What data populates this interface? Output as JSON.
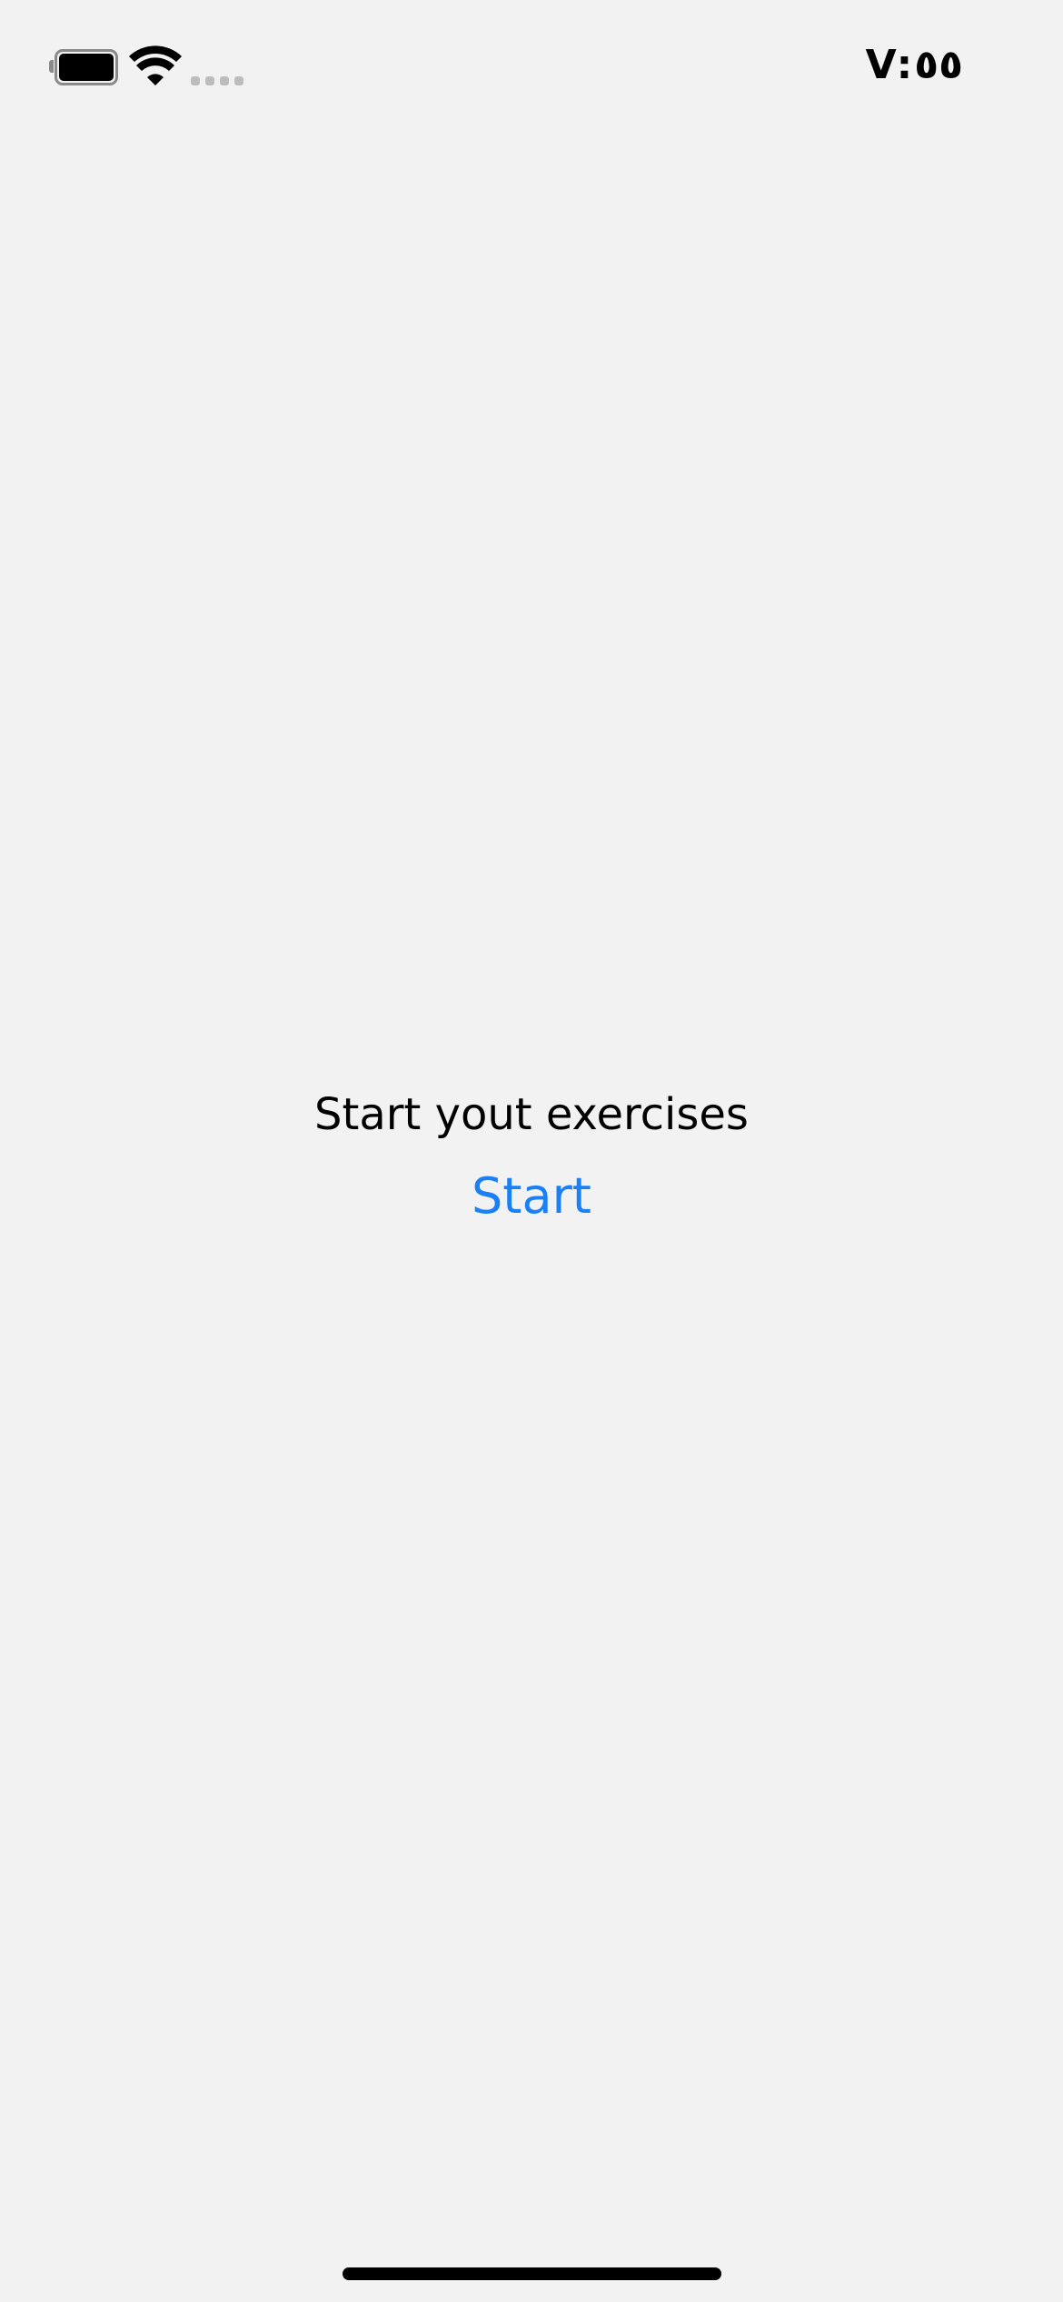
{
  "status_bar": {
    "time": "V:٥٥",
    "battery_icon": "battery-icon",
    "wifi_icon": "wifi-icon",
    "signal_icon": "cellular-signal-icon"
  },
  "main": {
    "prompt": "Start yout exercises",
    "start_label": "Start"
  },
  "colors": {
    "background": "#f2f2f2",
    "accent": "#1a80f5",
    "text": "#000000"
  }
}
